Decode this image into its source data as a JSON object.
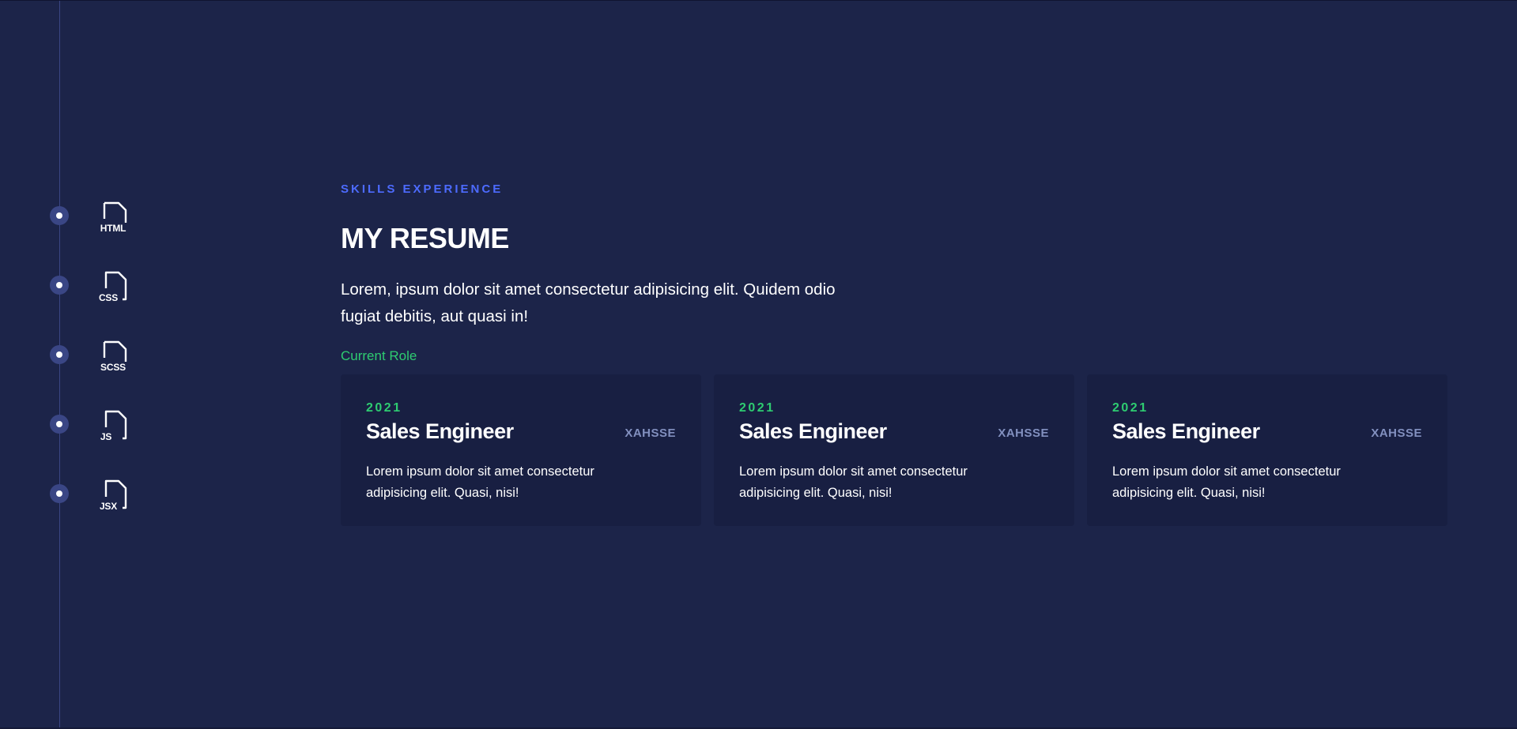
{
  "colors": {
    "background": "#1c2449",
    "card_background": "#181f42",
    "accent_blue": "#4d6bff",
    "accent_green": "#2ecc71",
    "muted": "#8290bf",
    "timeline": "#3a4684"
  },
  "skills": [
    {
      "label": "HTML",
      "icon": "file-icon"
    },
    {
      "label": "CSS",
      "icon": "file-icon"
    },
    {
      "label": "SCSS",
      "icon": "file-icon"
    },
    {
      "label": "JS",
      "icon": "file-icon"
    },
    {
      "label": "JSX",
      "icon": "file-icon"
    }
  ],
  "resume": {
    "eyebrow": "SKILLS EXPERIENCE",
    "title": "MY RESUME",
    "intro": "Lorem, ipsum dolor sit amet consectetur adipisicing elit. Quidem odio fugiat debitis, aut quasi in!",
    "section_label": "Current Role"
  },
  "cards": [
    {
      "year": "2021",
      "title": "Sales Engineer",
      "company": "XAHSSE",
      "text": "Lorem ipsum dolor sit amet consectetur adipisicing elit. Quasi, nisi!"
    },
    {
      "year": "2021",
      "title": "Sales Engineer",
      "company": "XAHSSE",
      "text": "Lorem ipsum dolor sit amet consectetur adipisicing elit. Quasi, nisi!"
    },
    {
      "year": "2021",
      "title": "Sales Engineer",
      "company": "XAHSSE",
      "text": "Lorem ipsum dolor sit amet consectetur adipisicing elit. Quasi, nisi!"
    }
  ]
}
